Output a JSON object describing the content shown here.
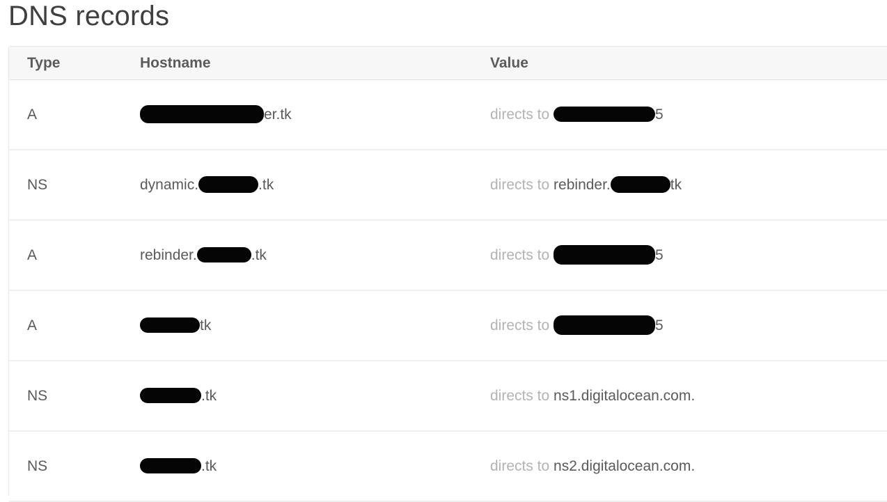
{
  "page": {
    "title": "DNS records"
  },
  "table": {
    "headers": {
      "type": "Type",
      "hostname": "Hostname",
      "value": "Value"
    },
    "directs_to_label": "directs to",
    "rows": [
      {
        "type": "A",
        "host_prefix": "",
        "host_redacted": true,
        "host_suffix": "er.tk",
        "value_prefix": "",
        "value_redacted": true,
        "value_suffix": "5"
      },
      {
        "type": "NS",
        "host_prefix": "dynamic.",
        "host_redacted": true,
        "host_suffix": ".tk",
        "value_prefix": "rebinder.",
        "value_redacted": true,
        "value_suffix": "tk"
      },
      {
        "type": "A",
        "host_prefix": "rebinder.",
        "host_redacted": true,
        "host_suffix": ".tk",
        "value_prefix": "",
        "value_redacted": true,
        "value_suffix": "5"
      },
      {
        "type": "A",
        "host_prefix": "",
        "host_redacted": true,
        "host_suffix": "tk",
        "value_prefix": "",
        "value_redacted": true,
        "value_suffix": "5"
      },
      {
        "type": "NS",
        "host_prefix": "",
        "host_redacted": true,
        "host_suffix": ".tk",
        "value_prefix": "ns1.digitalocean.com.",
        "value_redacted": false,
        "value_suffix": ""
      },
      {
        "type": "NS",
        "host_prefix": "",
        "host_redacted": true,
        "host_suffix": ".tk",
        "value_prefix": "ns2.digitalocean.com.",
        "value_redacted": false,
        "value_suffix": ""
      }
    ]
  },
  "colors": {
    "title": "#3f3f3f",
    "header_bg": "#f7f7f7",
    "muted_text": "#b3b3b3",
    "body_text": "#5a5a5a",
    "redaction": "#050505"
  }
}
